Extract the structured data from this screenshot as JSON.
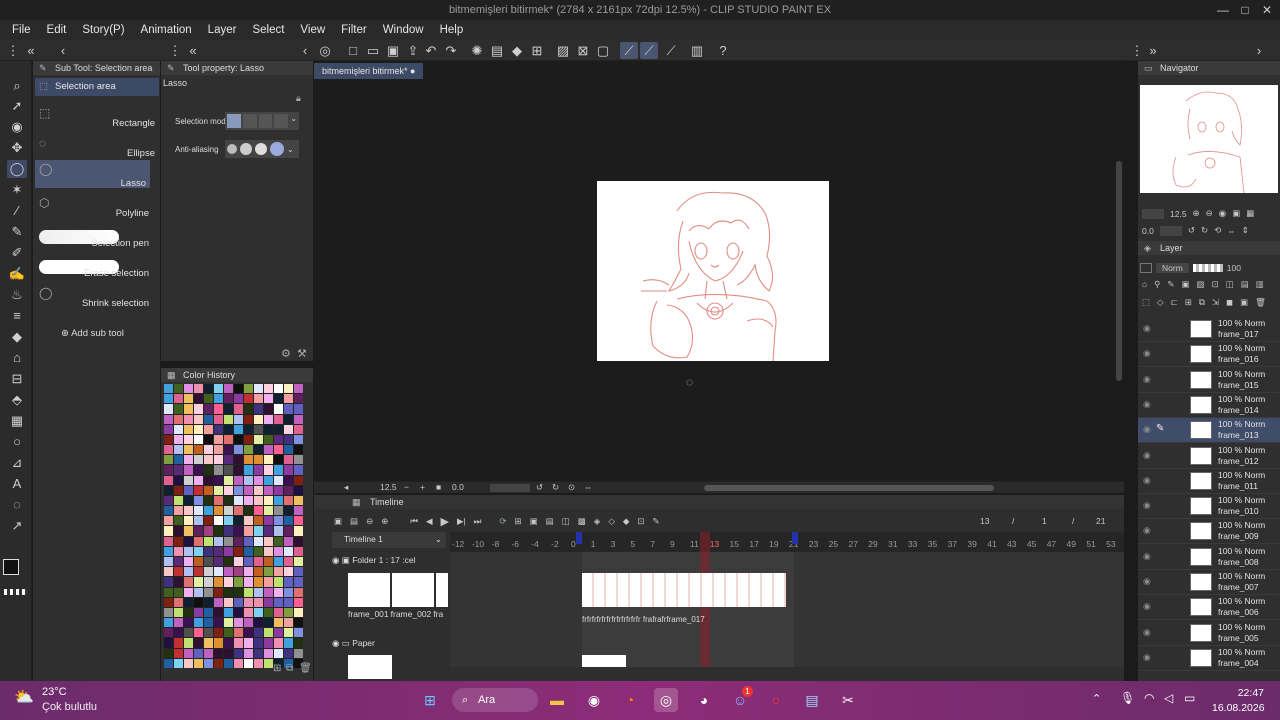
{
  "window": {
    "title": "bitmemişleri bitirmek* (2784 x 2161px 72dpi 12.5%) - CLIP STUDIO PAINT EX",
    "minimize": "—",
    "maximize": "□",
    "close": "✕"
  },
  "menu": [
    "File",
    "Edit",
    "Story(P)",
    "Animation",
    "Layer",
    "Select",
    "View",
    "Filter",
    "Window",
    "Help"
  ],
  "subtool": {
    "tab": "Sub Tool: Selection area",
    "group": "Selection area",
    "items": [
      "Rectangle",
      "Ellipse",
      "Lasso",
      "Polyline",
      "Selection pen",
      "Erase selection",
      "Shrink selection"
    ],
    "selected": "Lasso",
    "add": "Add sub tool"
  },
  "toolprop": {
    "tab": "Tool property: Lasso",
    "name": "Lasso",
    "mode_label": "Selection mode",
    "aa_label": "Anti-aliasing"
  },
  "colorhist": {
    "tab": "Color History"
  },
  "canvas": {
    "doc_tab": "bitmemişleri bitirmek*",
    "zoom": "12.5",
    "angle": "0.0"
  },
  "navigator": {
    "tab": "Navigator",
    "zoom": "12.5",
    "angle": "0.0"
  },
  "layer": {
    "tab": "Layer",
    "blend": "Norm",
    "opacity": "100",
    "rows": [
      {
        "o": "100 % Norm",
        "n": "frame_017"
      },
      {
        "o": "100 % Norm",
        "n": "frame_016"
      },
      {
        "o": "100 % Norm",
        "n": "frame_015"
      },
      {
        "o": "100 % Norm",
        "n": "frame_014"
      },
      {
        "o": "100 % Norm",
        "n": "frame_013"
      },
      {
        "o": "100 % Norm",
        "n": "frame_012"
      },
      {
        "o": "100 % Norm",
        "n": "frame_011"
      },
      {
        "o": "100 % Norm",
        "n": "frame_010"
      },
      {
        "o": "100 % Norm",
        "n": "frame_009"
      },
      {
        "o": "100 % Norm",
        "n": "frame_008"
      },
      {
        "o": "100 % Norm",
        "n": "frame_007"
      },
      {
        "o": "100 % Norm",
        "n": "frame_006"
      },
      {
        "o": "100 % Norm",
        "n": "frame_005"
      },
      {
        "o": "100 % Norm",
        "n": "frame_004"
      }
    ],
    "selected_index": 4
  },
  "timeline": {
    "tab": "Timeline",
    "name": "Timeline 1",
    "current": "13",
    "start": "1",
    "end": "21",
    "sep": "/",
    "ruler": [
      "-12",
      "-10",
      "-8",
      "-6",
      "-4",
      "-2",
      "0",
      "1",
      "3",
      "5",
      "7",
      "9",
      "11",
      "13",
      "15",
      "17",
      "19",
      "21",
      "23",
      "25",
      "27",
      "29",
      "31",
      "33",
      "35",
      "37",
      "39",
      "41",
      "43",
      "45",
      "47",
      "49",
      "51",
      "53"
    ],
    "folder": "Folder 1 : 17 :cel",
    "paper": "Paper",
    "thumbs": [
      "frame_001",
      "frame_002",
      "fra"
    ],
    "cel_label": "frame_017",
    "cel_strip": "frfrfrfrfrfrfrfrfrfrfrfr frafrafrframe_017"
  },
  "taskbar": {
    "temp": "23°C",
    "weather": "Çok bulutlu",
    "search": "Ara",
    "time": "22:47",
    "date": "16.08.2026",
    "badge": "1"
  },
  "colors": {
    "accent": "#4b5672",
    "sketch": "#e28d86"
  }
}
